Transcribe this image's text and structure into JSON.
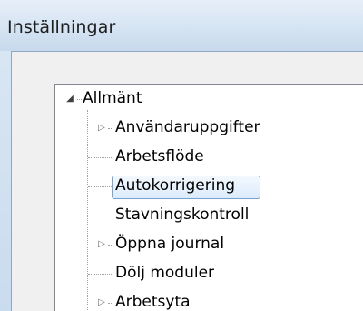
{
  "window": {
    "title": "Inställningar"
  },
  "tree": {
    "root": {
      "label": "Allmänt",
      "expanded": true
    },
    "items": [
      {
        "label": "Användaruppgifter",
        "expandable": true,
        "selected": false
      },
      {
        "label": "Arbetsflöde",
        "expandable": false,
        "selected": false
      },
      {
        "label": "Autokorrigering",
        "expandable": false,
        "selected": true
      },
      {
        "label": "Stavningskontroll",
        "expandable": false,
        "selected": false
      },
      {
        "label": "Öppna journal",
        "expandable": true,
        "selected": false
      },
      {
        "label": "Dölj moduler",
        "expandable": false,
        "selected": false
      },
      {
        "label": "Arbetsyta",
        "expandable": true,
        "selected": false
      }
    ]
  }
}
